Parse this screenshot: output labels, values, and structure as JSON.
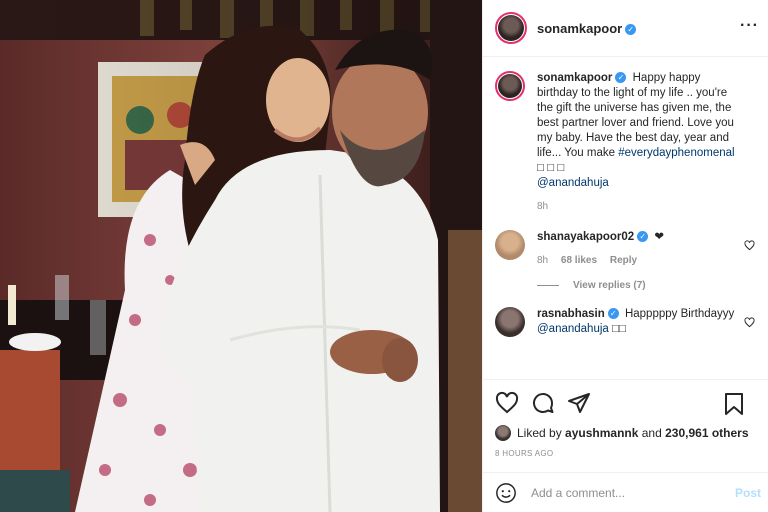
{
  "post": {
    "username": "sonamkapoor",
    "verified_mark": "✓",
    "more_label": "···",
    "caption": {
      "text": "Happy happy birthday to the light of my life .. you're the gift the universe has given me, the best partner lover and friend. Love you my baby. Have the best day, year and life... You make",
      "hashtag": "#everydayphenomenal",
      "emojis": "□ □ □",
      "mention": "@anandahuja",
      "time": "8h"
    },
    "comments": [
      {
        "username": "shanayakapoor02",
        "text": "❤",
        "time": "8h",
        "likes": "68 likes",
        "reply": "Reply",
        "view_replies": "View replies (7)"
      },
      {
        "username": "rasnabhasin",
        "text": "Happpppy Birthdayyy",
        "mention": "@anandahuja",
        "emojis": "□□"
      }
    ],
    "liked_by_prefix": "Liked by",
    "liked_by_user": "ayushmannk",
    "liked_by_and": "and",
    "liked_by_count": "230,961 others",
    "timestamp": "8 HOURS AGO",
    "add_comment_placeholder": "Add a comment...",
    "post_label": "Post"
  }
}
